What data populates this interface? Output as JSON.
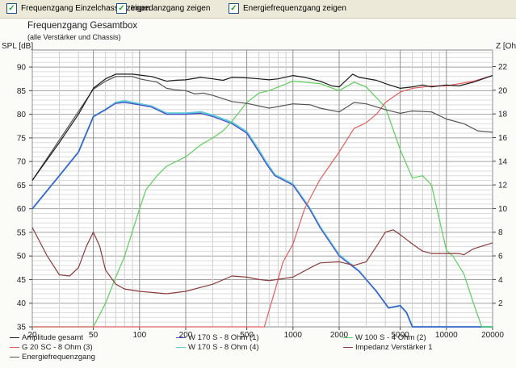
{
  "toolbar": {
    "checkboxes": [
      {
        "label": "Frequenzgang Einzelchassis zeigen",
        "checked": true
      },
      {
        "label": "Impedanzgang zeigen",
        "checked": true
      },
      {
        "label": "Energiefrequenzgang zeigen",
        "checked": true
      }
    ],
    "check_glyph": "✓"
  },
  "chart_data": {
    "type": "line",
    "title": "Frequenzgang Gesamtbox",
    "subtitle": "(alle Verstärker und Chassis)",
    "ylabel": "SPL [dB]",
    "y2label": "Z [Ohm]",
    "xscale": "log",
    "xlim": [
      20,
      20000
    ],
    "ylim": [
      35,
      93.6
    ],
    "y2lim": [
      0,
      23.4
    ],
    "xticks": [
      20,
      50,
      100,
      200,
      500,
      1000,
      2000,
      5000,
      10000,
      20000
    ],
    "xtick_labels": [
      "20",
      "50",
      "100",
      "200",
      "500",
      "1000",
      "2000",
      "5000",
      "10000",
      "20000"
    ],
    "yticks": [
      90,
      85,
      80,
      75,
      70,
      65,
      60,
      55,
      50,
      45,
      40,
      35
    ],
    "ytick_labels": [
      "90",
      "85",
      "80",
      "75",
      "70",
      "65",
      "60",
      "55",
      "50",
      "45",
      "40",
      "35"
    ],
    "y2ticks": [
      22,
      20,
      18,
      16,
      14,
      12,
      10,
      8,
      6,
      4,
      2
    ],
    "y2tick_labels": [
      "22",
      "20",
      "18",
      "16",
      "14",
      "12",
      "10",
      "8",
      "6",
      "4",
      "2"
    ],
    "grid": true,
    "legend_position": "bottom",
    "series": [
      {
        "name": "Amplitude gesamt",
        "color": "#1a1a1a",
        "axis": "left",
        "x": [
          20,
          30,
          40,
          50,
          60,
          70,
          90,
          100,
          120,
          150,
          170,
          200,
          250,
          300,
          350,
          400,
          500,
          600,
          700,
          800,
          1000,
          1200,
          1500,
          1800,
          2000,
          2450,
          2700,
          3500,
          4000,
          5000,
          6000,
          7000,
          8000,
          10000,
          12000,
          15000,
          20000
        ],
        "y": [
          66,
          74,
          80,
          85.5,
          87.5,
          88.5,
          88.5,
          88.3,
          88,
          87,
          87.2,
          87.3,
          87.8,
          87.5,
          87.2,
          87.8,
          87.7,
          87.5,
          87.3,
          87.5,
          88.2,
          87.8,
          87,
          86,
          85.8,
          88.5,
          87.8,
          87.2,
          86.5,
          85.5,
          85.8,
          86.2,
          85.8,
          86.2,
          86,
          86.8,
          88.2
        ]
      },
      {
        "name": "W 170 S - 8 Ohm (1)",
        "color": "#4848c8",
        "axis": "left",
        "x": [
          20,
          30,
          40,
          50,
          60,
          70,
          80,
          100,
          120,
          150,
          200,
          250,
          300,
          400,
          500,
          600,
          670,
          760,
          1000,
          1280,
          1500,
          2000,
          2700,
          3500,
          4200,
          5000,
          5500,
          6000,
          20000
        ],
        "y": [
          60,
          67,
          72,
          79.5,
          81,
          82.3,
          82.5,
          82,
          81.5,
          80,
          80,
          80.2,
          79.5,
          78,
          76,
          72,
          69.5,
          67,
          65,
          60,
          56,
          50,
          46.7,
          42.5,
          39,
          39.5,
          38,
          35,
          35
        ]
      },
      {
        "name": "W 100 S - 4 Ohm (2)",
        "color": "#5ccf5c",
        "axis": "left",
        "x": [
          20,
          50,
          60,
          70,
          80,
          100,
          110,
          130,
          150,
          200,
          250,
          300,
          350,
          400,
          500,
          600,
          700,
          1000,
          1500,
          2000,
          2500,
          3000,
          4000,
          5000,
          6000,
          7000,
          8000,
          10000,
          11000,
          13000,
          15000,
          17000,
          20000
        ],
        "y": [
          35,
          35,
          40,
          45.5,
          50,
          60,
          64,
          67,
          69,
          71,
          73.5,
          75,
          76.5,
          78.5,
          82.5,
          84.5,
          85,
          87,
          86.5,
          85,
          86.8,
          85.8,
          81.5,
          72.5,
          66.5,
          67,
          65,
          51.2,
          50,
          46.2,
          40,
          35,
          35
        ]
      },
      {
        "name": "G 20 SC - 8 Ohm (3)",
        "color": "#e06060",
        "axis": "left",
        "x": [
          20,
          650,
          760,
          860,
          1000,
          1190,
          1500,
          2000,
          2500,
          3000,
          3500,
          4000,
          5000,
          6000,
          8000,
          10000,
          15000,
          20000
        ],
        "y": [
          35,
          35,
          42.5,
          48.7,
          52.5,
          60,
          66.2,
          72,
          77,
          78.2,
          80,
          82.5,
          84.7,
          85.5,
          86,
          86,
          87,
          88.2
        ]
      },
      {
        "name": "W 170 S - 8 Ohm (4)",
        "color": "#5cc8d8",
        "axis": "left",
        "x": [
          20,
          30,
          40,
          50,
          60,
          70,
          80,
          100,
          120,
          150,
          200,
          250,
          300,
          400,
          500,
          600,
          670,
          760,
          1000,
          1280,
          1500,
          2000,
          2700,
          3500,
          4200,
          5000,
          5500,
          6000,
          20000
        ],
        "y": [
          60,
          67,
          72,
          79.5,
          81,
          82.5,
          82.8,
          82.2,
          81.7,
          80.2,
          80.2,
          80.5,
          79.8,
          78.3,
          76.3,
          72.4,
          69.8,
          67.2,
          65.2,
          60.2,
          56.2,
          50.2,
          46.8,
          42.5,
          39,
          39.5,
          38,
          35,
          35
        ]
      },
      {
        "name": "Impedanz Verstärker 1",
        "color": "#8c3c3c",
        "axis": "right",
        "x": [
          20,
          25,
          30,
          35,
          40,
          45,
          50,
          55,
          60,
          70,
          80,
          100,
          150,
          200,
          300,
          400,
          500,
          600,
          700,
          1000,
          1300,
          1500,
          2000,
          2500,
          3000,
          3500,
          4000,
          4500,
          5000,
          6000,
          7000,
          8000,
          10000,
          12000,
          13000,
          15000,
          20000
        ],
        "y": [
          8.4,
          6,
          4.4,
          4.3,
          5,
          6.8,
          8,
          6.8,
          4.8,
          3.6,
          3.2,
          3,
          2.8,
          3,
          3.6,
          4.3,
          4.2,
          4,
          3.9,
          4.2,
          5,
          5.4,
          5.5,
          5.2,
          5.5,
          6.8,
          8,
          8.2,
          7.8,
          7,
          6.4,
          6.2,
          6.2,
          6.2,
          6.1,
          6.6,
          7.1
        ]
      },
      {
        "name": "Energiefrequenzgang",
        "color": "#555555",
        "axis": "left",
        "x": [
          20,
          50,
          60,
          70,
          90,
          100,
          130,
          150,
          170,
          200,
          230,
          260,
          300,
          400,
          500,
          700,
          1000,
          1300,
          1500,
          2000,
          2500,
          3000,
          4000,
          5000,
          6000,
          8000,
          10000,
          13000,
          16000,
          20000
        ],
        "y": [
          66,
          85.3,
          87,
          88,
          88,
          87.5,
          86.8,
          85.5,
          85.2,
          85,
          84.3,
          84.5,
          84,
          82.7,
          82.3,
          81.3,
          82.2,
          82,
          81.3,
          80.5,
          82.5,
          82.2,
          81,
          80.2,
          80.7,
          80.5,
          79,
          78,
          76.5,
          76.2
        ]
      }
    ]
  }
}
